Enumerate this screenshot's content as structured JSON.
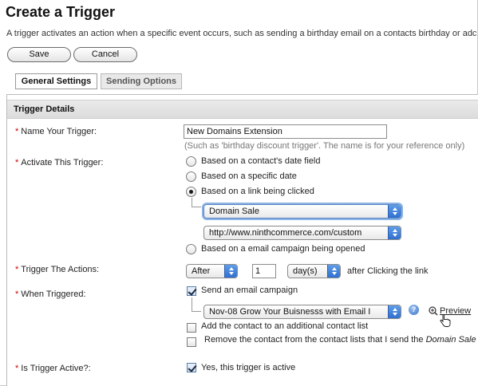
{
  "header": {
    "title": "Create a Trigger",
    "intro": "A trigger activates an action when a specific event occurs, such as sending a birthday email on a contacts birthday or adc"
  },
  "toolbar": {
    "save_label": "Save",
    "cancel_label": "Cancel"
  },
  "tabs": [
    {
      "label": "General Settings",
      "active": true
    },
    {
      "label": "Sending Options",
      "active": false
    }
  ],
  "section": {
    "title": "Trigger Details"
  },
  "form": {
    "name": {
      "label": "Name Your Trigger:",
      "value": "New Domains Extension",
      "hint": "(Such as 'birthday discount trigger'. The name is for your reference only)"
    },
    "activate": {
      "label": "Activate This Trigger:",
      "options": [
        "Based on a contact's date field",
        "Based on a specific date",
        "Based on a link being clicked",
        "Based on a email campaign being opened"
      ],
      "selected_index": 2,
      "campaign_select": "Domain Sale",
      "link_select": "http://www.ninthcommerce.com/custom"
    },
    "actions": {
      "label": "Trigger The Actions:",
      "timing_select": "After",
      "quantity": "1",
      "unit_select": "day(s)",
      "suffix": "after Clicking the link"
    },
    "when_triggered": {
      "label": "When Triggered:",
      "send_email_label": "Send an email campaign",
      "send_email_checked": true,
      "email_campaign_select": "Nov-08 Grow Your Buisnesss with Email I",
      "help_glyph": "?",
      "preview_label": "Preview",
      "add_contact_label": "Add the contact to an additional contact list",
      "add_contact_checked": false,
      "remove_contact_label": "Remove the contact from the contact lists that I send the",
      "remove_contact_label_italic": "Domain Sale",
      "remove_contact_checked": false
    },
    "active": {
      "label": "Is Trigger Active?:",
      "checkbox_label": "Yes, this trigger is active",
      "checked": true
    }
  },
  "required_marker": "*",
  "colors": {
    "required": "#cc0000",
    "select_arrow": "#2f6fd0",
    "section_bar": "#e2e2e2"
  }
}
